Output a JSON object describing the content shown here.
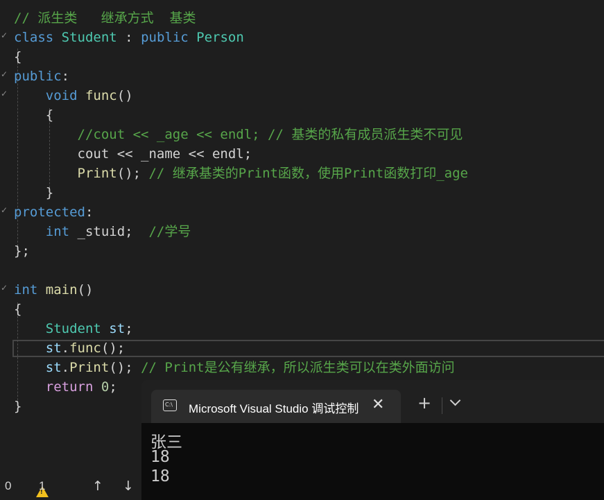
{
  "editor": {
    "lines": [
      [
        {
          "t": "// 派生类   继承方式  基类",
          "c": "cm"
        }
      ],
      [
        {
          "t": "class",
          "c": "kw"
        },
        {
          "t": " "
        },
        {
          "t": "Student",
          "c": "type"
        },
        {
          "t": " : "
        },
        {
          "t": "public",
          "c": "kw"
        },
        {
          "t": " "
        },
        {
          "t": "Person",
          "c": "type"
        }
      ],
      [
        {
          "t": "{"
        }
      ],
      [
        {
          "t": "public",
          "c": "kw"
        },
        {
          "t": ":"
        }
      ],
      [
        {
          "t": "    "
        },
        {
          "t": "void",
          "c": "kw"
        },
        {
          "t": " "
        },
        {
          "t": "func",
          "c": "fn"
        },
        {
          "t": "()"
        }
      ],
      [
        {
          "t": "    {"
        }
      ],
      [
        {
          "t": "        "
        },
        {
          "t": "//cout << _age << endl; // 基类的私有成员派生类不可见",
          "c": "cm"
        }
      ],
      [
        {
          "t": "        cout << _name << endl;"
        }
      ],
      [
        {
          "t": "        "
        },
        {
          "t": "Print",
          "c": "fn"
        },
        {
          "t": "(); "
        },
        {
          "t": "// 继承基类的Print函数，使用Print函数打印_age",
          "c": "cm"
        }
      ],
      [
        {
          "t": "    }"
        }
      ],
      [
        {
          "t": "protected",
          "c": "kw"
        },
        {
          "t": ":"
        }
      ],
      [
        {
          "t": "    "
        },
        {
          "t": "int",
          "c": "kw"
        },
        {
          "t": " _stuid;  "
        },
        {
          "t": "//学号",
          "c": "cm"
        }
      ],
      [
        {
          "t": "};"
        }
      ],
      [],
      [
        {
          "t": "int",
          "c": "kw"
        },
        {
          "t": " "
        },
        {
          "t": "main",
          "c": "fn"
        },
        {
          "t": "()"
        }
      ],
      [
        {
          "t": "{"
        }
      ],
      [
        {
          "t": "    "
        },
        {
          "t": "Student",
          "c": "type"
        },
        {
          "t": " "
        },
        {
          "t": "st",
          "c": "var"
        },
        {
          "t": ";"
        }
      ],
      [
        {
          "t": "    "
        },
        {
          "t": "st",
          "c": "var"
        },
        {
          "t": "."
        },
        {
          "t": "func",
          "c": "fn"
        },
        {
          "t": "();"
        }
      ],
      [
        {
          "t": "    "
        },
        {
          "t": "st",
          "c": "var"
        },
        {
          "t": "."
        },
        {
          "t": "Print",
          "c": "fn"
        },
        {
          "t": "(); "
        },
        {
          "t": "// Print是公有继承，所以派生类可以在类外面访问",
          "c": "cm"
        }
      ],
      [
        {
          "t": "    "
        },
        {
          "t": "return",
          "c": "kw2"
        },
        {
          "t": " "
        },
        {
          "t": "0",
          "c": "num"
        },
        {
          "t": ";"
        }
      ],
      [
        {
          "t": "}"
        }
      ]
    ]
  },
  "status_bar": {
    "line_col": "0",
    "warning_count": "1",
    "prev_icon": "arrow-up-icon",
    "next_icon": "arrow-down-icon",
    "warning_color": "#f2c01e"
  },
  "terminal": {
    "tab_title": "Microsoft Visual Studio 调试控制台",
    "close_glyph": "✕",
    "new_tab_glyph": "+",
    "output_lines": [
      "张三",
      "18",
      "18"
    ]
  }
}
